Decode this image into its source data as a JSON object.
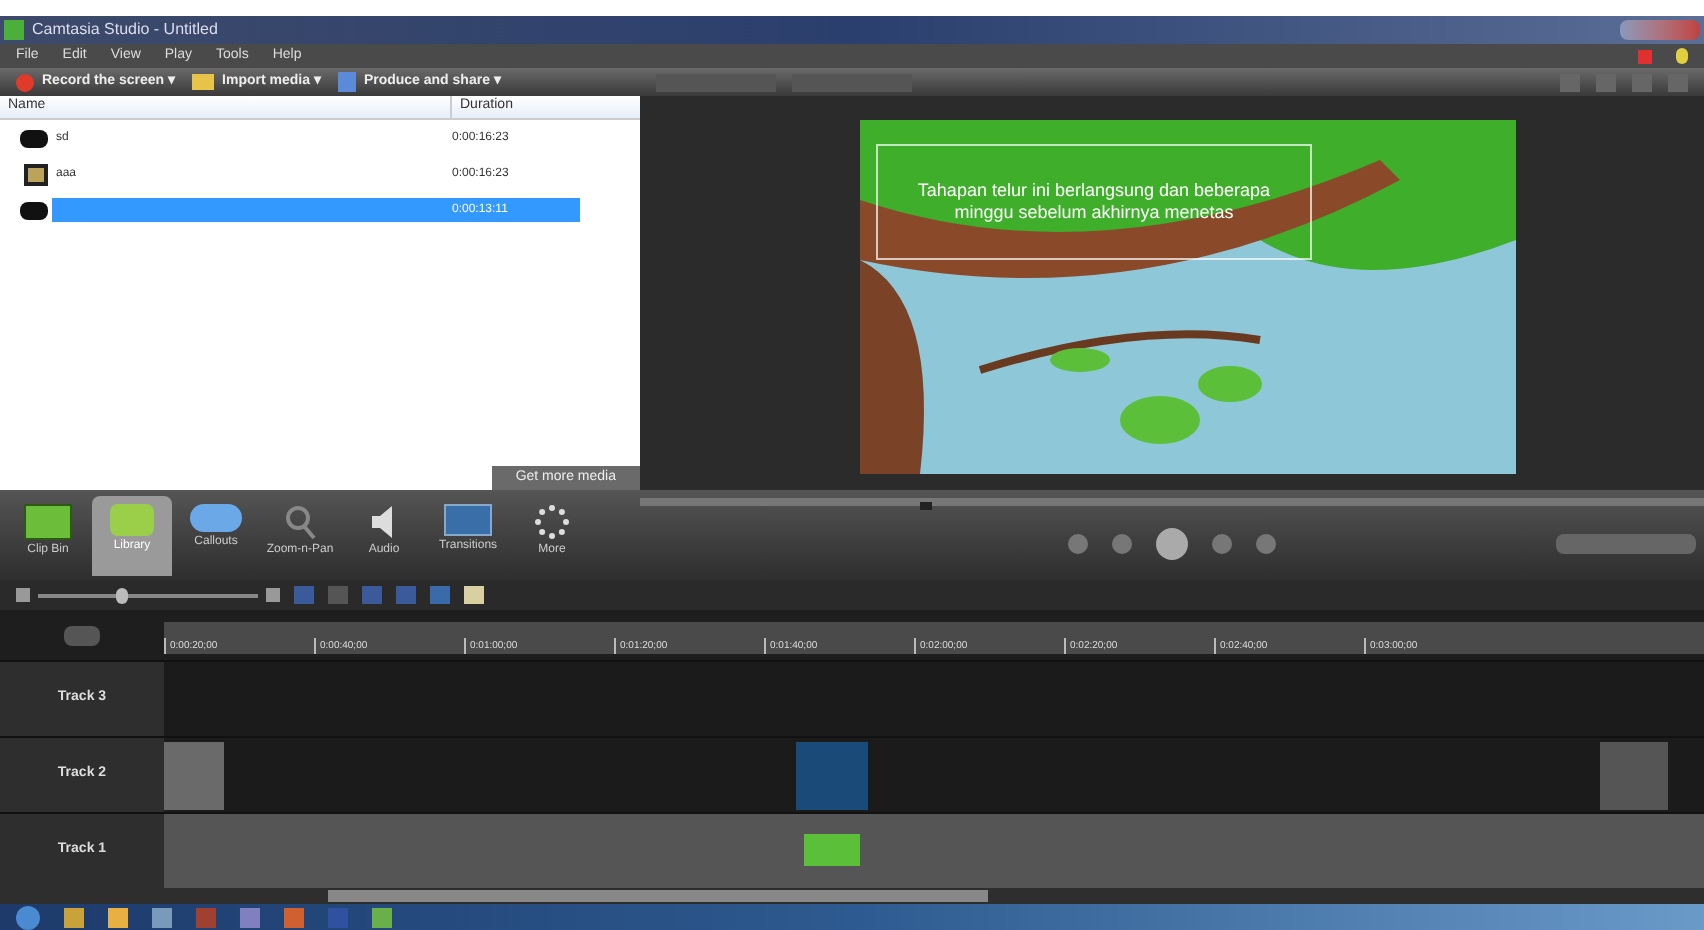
{
  "window": {
    "title": "Camtasia Studio - Untitled"
  },
  "menu": [
    "File",
    "Edit",
    "View",
    "Play",
    "Tools",
    "Help"
  ],
  "toolbar": [
    {
      "label": "Record the screen ▾",
      "kind": "record"
    },
    {
      "label": "Import media ▾",
      "kind": "import"
    },
    {
      "label": "Produce and share ▾",
      "kind": "produce"
    }
  ],
  "library": {
    "columns": [
      "Name",
      "Duration"
    ],
    "rows": [
      {
        "name": "sd",
        "duration": "0:00:16:23",
        "kind": "video",
        "selected": false
      },
      {
        "name": "aaa",
        "duration": "0:00:16:23",
        "kind": "image",
        "selected": false
      },
      {
        "duration": "0:00:13:11",
        "kind": "video",
        "selected": true
      }
    ]
  },
  "get_more_media": "Get more media",
  "preview": {
    "caption": "Tahapan telur ini berlangsung dan beberapa minggu sebelum akhirnya menetas"
  },
  "tabs": [
    {
      "label": "Clip Bin",
      "kind": "clipbin",
      "selected": false
    },
    {
      "label": "Library",
      "kind": "library",
      "selected": true
    },
    {
      "label": "Callouts",
      "kind": "callouts",
      "selected": false
    },
    {
      "label": "Zoom-n-Pan",
      "kind": "zoom",
      "selected": false
    },
    {
      "label": "Audio",
      "kind": "audio",
      "selected": false
    },
    {
      "label": "Transitions",
      "kind": "transitions",
      "selected": false
    },
    {
      "label": "More",
      "kind": "more",
      "selected": false
    }
  ],
  "timeline": {
    "zoom": {
      "level": 0.35
    },
    "ruler": [
      "0:00:20;00",
      "0:00:40;00",
      "0:01:00;00",
      "0:01:20;00",
      "0:01:40;00",
      "0:02:00;00",
      "0:02:20;00",
      "0:02:40;00",
      "0:03:00;00"
    ],
    "tracks": [
      {
        "label": "Track 3"
      },
      {
        "label": "Track 2"
      },
      {
        "label": "Track 1"
      }
    ]
  }
}
